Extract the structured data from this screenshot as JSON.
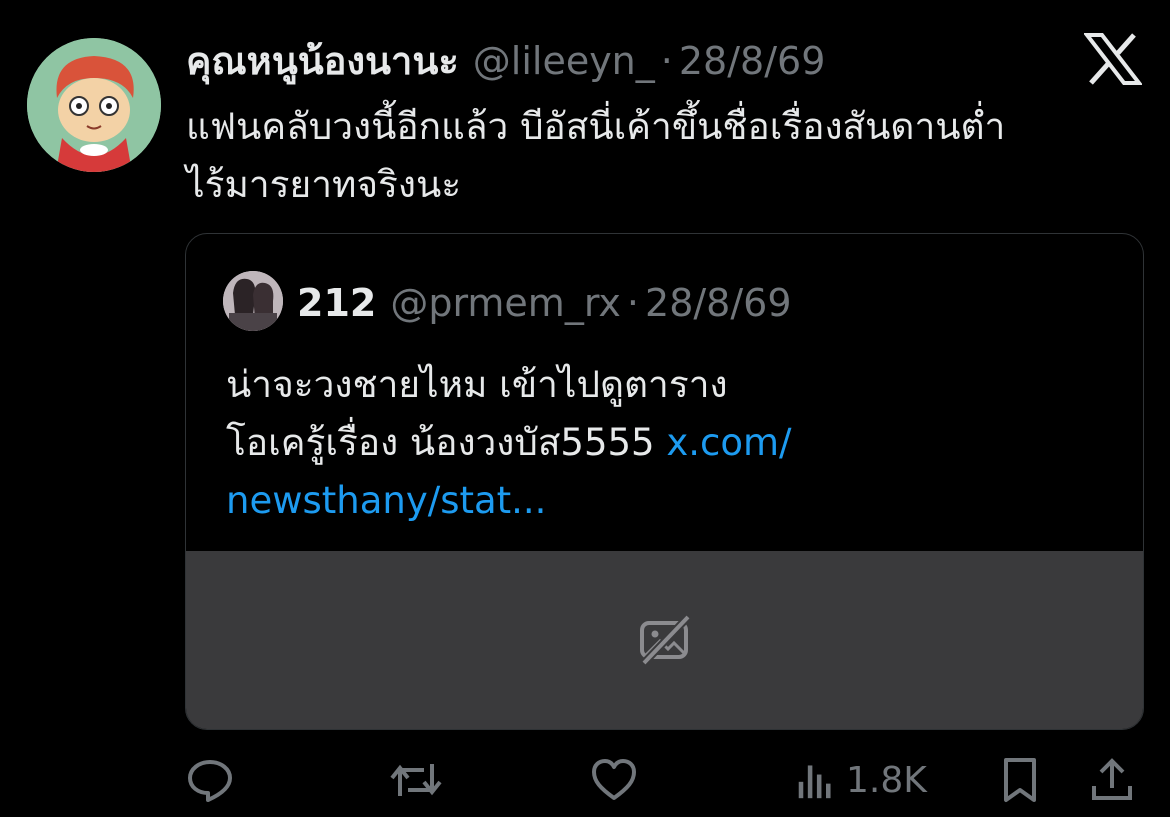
{
  "tweet": {
    "display_name": "คุณหนูน้องนานะ",
    "handle": "@lileeyn_",
    "separator": "·",
    "date": "28/8/69",
    "text_line1": "แฟนคลับวงนี้อีกแล้ว บีอัสนี่เค้าขึ้นชื่อเรื่องสันดานต่ำ",
    "text_line2": "ไร้มารยาทจริงนะ"
  },
  "quoted_tweet": {
    "display_name": "212",
    "handle": "@prmem_rx",
    "separator": "·",
    "date": "28/8/69",
    "text_line1": "น่าจะวงชายไหม เข้าไปดูตาราง",
    "text_line2": "โอเครู้เรื่อง น้องวงบัส5555",
    "link_part1": "x.com/",
    "link_part2": "newsthany/stat..."
  },
  "actions": {
    "views_count": "1.8K"
  },
  "icons": {
    "logo": "x-logo-icon",
    "media_unavailable": "image-off-icon",
    "reply": "reply-icon",
    "retweet": "retweet-icon",
    "like": "heart-icon",
    "views": "views-bar-chart-icon",
    "bookmark": "bookmark-icon",
    "share": "share-icon"
  },
  "colors": {
    "background": "#000000",
    "text": "#e7e9ea",
    "secondary": "#71767b",
    "link": "#1d9bf0",
    "media_placeholder": "#3a3a3c"
  }
}
